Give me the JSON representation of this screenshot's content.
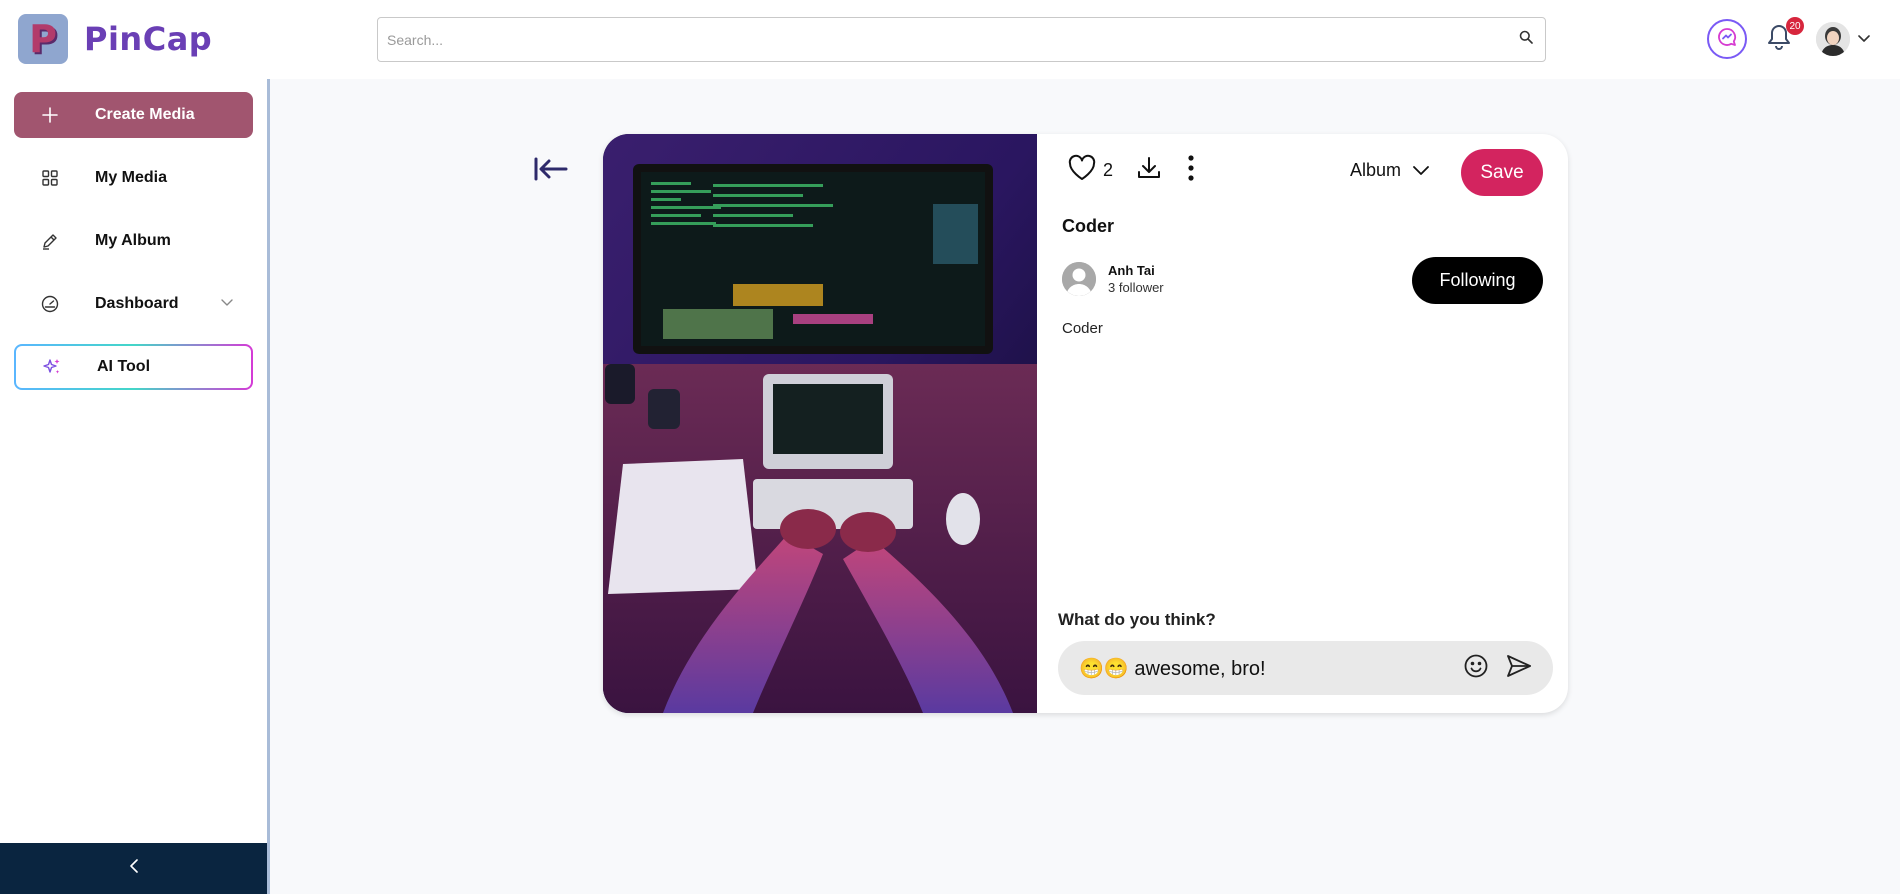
{
  "brand": {
    "logo_letter": "P",
    "name": "PinCap"
  },
  "search": {
    "placeholder": "Search..."
  },
  "header": {
    "notification_count": "20"
  },
  "sidebar": {
    "items": [
      {
        "label": "Create Media",
        "icon": "plus-icon"
      },
      {
        "label": "My Media",
        "icon": "grid-icon"
      },
      {
        "label": "My Album",
        "icon": "pen-icon"
      },
      {
        "label": "Dashboard",
        "icon": "gauge-icon"
      },
      {
        "label": "AI Tool",
        "icon": "sparkles-icon"
      }
    ]
  },
  "post": {
    "like_count": "2",
    "album_label": "Album",
    "save_label": "Save",
    "title": "Coder",
    "author_name": "Anh Tai",
    "author_followers": "3 follower",
    "follow_label": "Following",
    "description": "Coder",
    "comment_prompt": "What do you think?",
    "comment_value": "😁😁 awesome, bro!"
  },
  "colors": {
    "create_button": "#a1556f",
    "save_button": "#d3245f",
    "brand_text": "#6a3fb5",
    "sidebar_footer": "#0a2540"
  }
}
